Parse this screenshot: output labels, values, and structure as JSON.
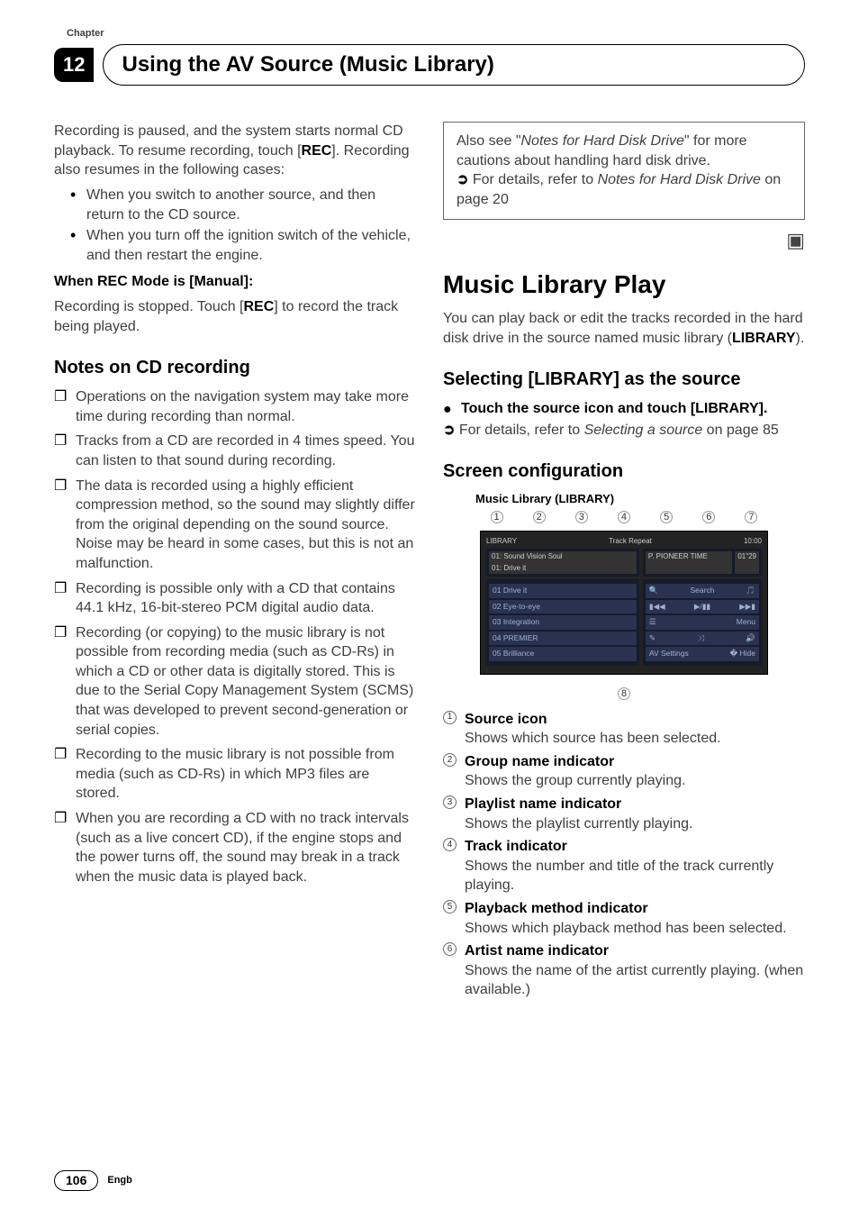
{
  "chapter": {
    "label": "Chapter",
    "number": "12",
    "title": "Using the AV Source (Music Library)"
  },
  "left": {
    "intro_p1_a": "Recording is paused, and the system starts normal CD playback. To resume recording, touch [",
    "intro_p1_b": "REC",
    "intro_p1_c": "]. Recording also resumes in the following cases:",
    "bullet1": "When you switch to another source, and then return to the CD source.",
    "bullet2": "When you turn off the ignition switch of the vehicle, and then restart the engine.",
    "manual_heading": "When REC Mode is [Manual]:",
    "manual_p_a": "Recording is stopped. Touch [",
    "manual_p_b": "REC",
    "manual_p_c": "] to record the track being played.",
    "notes_heading": "Notes on CD recording",
    "notes": [
      "Operations on the navigation system may take more time during recording than normal.",
      "Tracks from a CD are recorded in 4 times speed. You can listen to that sound during recording.",
      "The data is recorded using a highly efficient compression method, so the sound may slightly differ from the original depending on the sound source. Noise may be heard in some cases, but this is not an malfunction.",
      "Recording is possible only with a CD that contains 44.1 kHz, 16-bit-stereo PCM digital audio data.",
      "Recording (or copying) to the music library is not possible from recording media (such as CD-Rs) in which a CD or other data is digitally stored. This is due to the Serial Copy Management System (SCMS) that was developed to prevent second-generation or serial copies.",
      "Recording to the music library is not possible from media (such as CD-Rs) in which MP3 files are stored.",
      "When you are recording a CD with no track intervals (such as a live concert CD), if the engine stops and the power turns off, the sound may break in a track when the music data is played back."
    ]
  },
  "right": {
    "callout_a": "Also see \"",
    "callout_b": "Notes for Hard Disk Drive",
    "callout_c": "\" for more cautions about handling hard disk drive.",
    "callout_ref_a": "For details, refer to ",
    "callout_ref_b": "Notes for Hard Disk Drive",
    "callout_ref_c": " on page 20",
    "mlp_heading": "Music Library Play",
    "mlp_p_a": "You can play back or edit the tracks recorded in the hard disk drive in the source named music library (",
    "mlp_p_b": "LIBRARY",
    "mlp_p_c": ").",
    "sel_heading_a": "Selecting [",
    "sel_heading_b": "LIBRARY",
    "sel_heading_c": "] as the source",
    "sel_step_a": "Touch the source icon and touch [",
    "sel_step_b": "LIBRARY",
    "sel_step_c": "].",
    "sel_ref_a": "For details, refer to ",
    "sel_ref_b": "Selecting a source",
    "sel_ref_c": " on page 85",
    "screen_heading": "Screen configuration",
    "screenshot_title": "Music Library (LIBRARY)",
    "ss": {
      "topbar_left": "LIBRARY",
      "topbar_mid": "Track   Repeat",
      "topbar_right": "10:00",
      "g1": "01: Sound Vision Soul",
      "g2": "01: Drive it",
      "artist": "P. PIONEER TIME",
      "tracknum": "01\"29",
      "t1": "01 Drive it",
      "t2": "02 Eye-to-eye",
      "t3": "03 Integration",
      "t4": "04 PREMIER",
      "t5": "05 Brilliance",
      "search": "Search",
      "prev": "▮◀◀",
      "play": "▶/▮▮",
      "next": "▶▶▮",
      "list": "☰",
      "menu": "Menu",
      "edit": "✎",
      "rand": "⤨",
      "vol": "🔊",
      "av": "AV Settings",
      "hide": "� Hide"
    },
    "legend": [
      {
        "n": "1",
        "t": "Source icon",
        "d": "Shows which source has been selected."
      },
      {
        "n": "2",
        "t": "Group name indicator",
        "d": "Shows the group currently playing."
      },
      {
        "n": "3",
        "t": "Playlist name indicator",
        "d": "Shows the playlist currently playing."
      },
      {
        "n": "4",
        "t": "Track indicator",
        "d": "Shows the number and title of the track currently playing."
      },
      {
        "n": "5",
        "t": "Playback method indicator",
        "d": "Shows which playback method has been selected."
      },
      {
        "n": "6",
        "t": "Artist name indicator",
        "d": "Shows the name of the artist currently playing. (when available.)"
      }
    ]
  },
  "footer": {
    "page": "106",
    "lang": "Engb"
  }
}
